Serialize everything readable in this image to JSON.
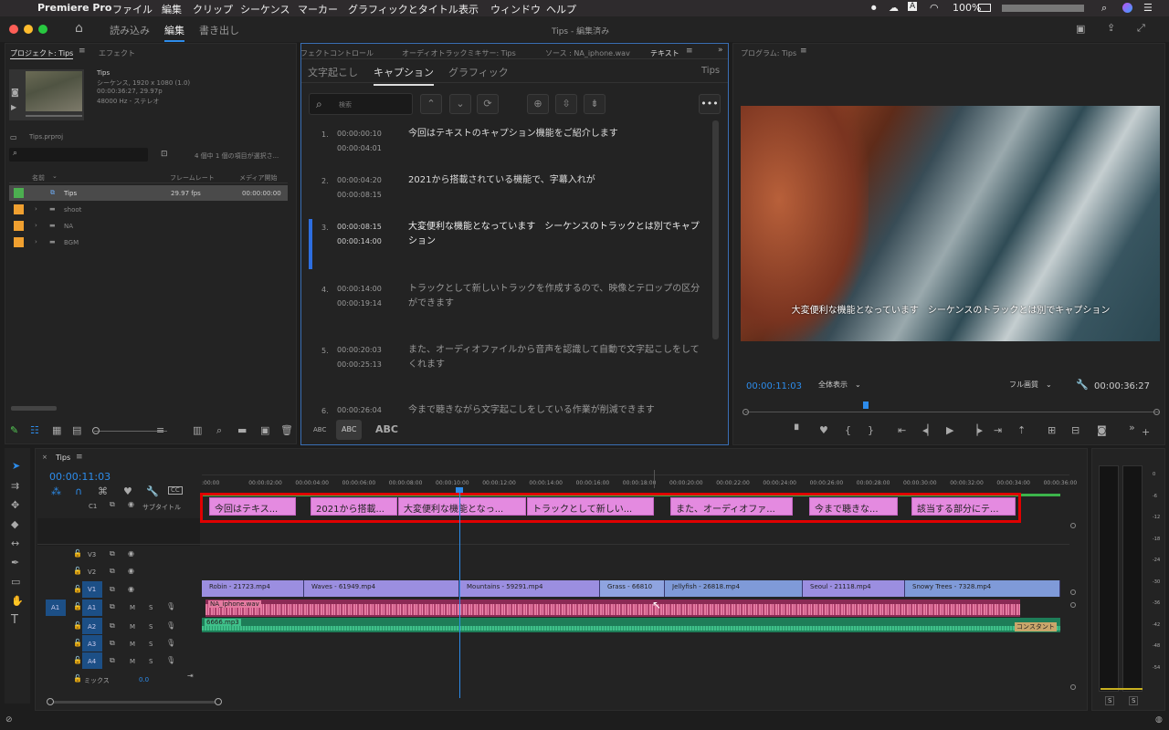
{
  "menubar": {
    "apple": "",
    "app": "Premiere Pro",
    "items": [
      "ファイル",
      "編集",
      "クリップ",
      "シーケンス",
      "マーカー",
      "グラフィックとタイトル",
      "表示",
      "ウィンドウ",
      "ヘルプ"
    ],
    "battery": "100%",
    "right_icons": [
      "search-icon",
      "control-center-icon",
      "siri-icon"
    ]
  },
  "appbar": {
    "workspaces": [
      "読み込み",
      "編集",
      "書き出し"
    ],
    "title": "Tips - 編集済み"
  },
  "project": {
    "tabs": [
      "プロジェクト: Tips",
      "エフェクト"
    ],
    "seq_name": "Tips",
    "seq_info1": "シーケンス, 1920 x 1080 (1.0)",
    "seq_info2": "00:00:36:27, 29.97p",
    "seq_info3": "48000 Hz - ステレオ",
    "file": "Tips.prproj",
    "selection": "4 個中 1 個の項目が選択さ...",
    "columns": [
      "名前",
      "フレームレート",
      "メディア開始"
    ],
    "rows": [
      {
        "name": "Tips",
        "fps": "29.97 fps",
        "start": "00:00:00:00",
        "color": "#4caf50"
      },
      {
        "name": "shoot",
        "fps": "",
        "start": "",
        "color": "#f0a030"
      },
      {
        "name": "NA",
        "fps": "",
        "start": "",
        "color": "#f0a030"
      },
      {
        "name": "BGM",
        "fps": "",
        "start": "",
        "color": "#f0a030"
      }
    ]
  },
  "textpanel": {
    "tabs": [
      "フェクトコントロール",
      "オーディオトラックミキサー: Tips",
      "ソース : NA_iphone.wav",
      "テキスト"
    ],
    "subtabs": [
      "文字起こし",
      "キャプション",
      "グラフィック"
    ],
    "seq": "Tips",
    "search_placeholder": "検索",
    "bottom": [
      "ABC",
      "ABC",
      "ABC"
    ],
    "captions": [
      {
        "num": "1.",
        "in": "00:00:00:10",
        "out": "00:00:04:01",
        "text": "今回はテキストのキャプション機能をご紹介します"
      },
      {
        "num": "2.",
        "in": "00:00:04:20",
        "out": "00:00:08:15",
        "text": "2021から搭載されている機能で、字幕入れが"
      },
      {
        "num": "3.",
        "in": "00:00:08:15",
        "out": "00:00:14:00",
        "text": "大変便利な機能となっています　シーケンスのトラックとは別でキャプション"
      },
      {
        "num": "4.",
        "in": "00:00:14:00",
        "out": "00:00:19:14",
        "text": "トラックとして新しいトラックを作成するので、映像とテロップの区分ができます"
      },
      {
        "num": "5.",
        "in": "00:00:20:03",
        "out": "00:00:25:13",
        "text": "また、オーディオファイルから音声を認識して自動で文字起こしをしてくれます"
      },
      {
        "num": "6.",
        "in": "00:00:26:04",
        "out": "",
        "text": "今まで聴きながら文字起こしをしている作業が削減できます"
      }
    ]
  },
  "program": {
    "tab": "プログラム: Tips",
    "subtitle": "大変便利な機能となっています　シーケンスのトラックとは別でキャプション",
    "timecode": "00:00:11:03",
    "fit": "全体表示",
    "quality": "フル画質",
    "duration": "00:00:36:27"
  },
  "timeline": {
    "tab": "Tips",
    "timecode": "00:00:11:03",
    "ruler": [
      ":00:00",
      "00:00:02:00",
      "00:00:04:00",
      "00:00:06:00",
      "00:00:08:00",
      "00:00:10:00",
      "00:00:12:00",
      "00:00:14:00",
      "00:00:16:00",
      "00:00:18:00",
      "00:00:20:00",
      "00:00:22:00",
      "00:00:24:00",
      "00:00:26:00",
      "00:00:28:00",
      "00:00:30:00",
      "00:00:32:00",
      "00:00:34:00",
      "00:00:36:00"
    ],
    "caption_track": "サブタイトル",
    "caption_track_id": "C1",
    "caption_clips": [
      "今回はテキス...",
      "2021から搭載...",
      "大変便利な機能となっ...",
      "トラックとして新しい...",
      "また、オーディオファ...",
      "今まで聴きな...",
      "該当する部分にテ..."
    ],
    "tracks": [
      "V3",
      "V2",
      "V1",
      "A1",
      "A2",
      "A3",
      "A4"
    ],
    "source_a1": "A1",
    "mix_label": "ミックス",
    "mix_value": "0.0",
    "video_clips": [
      "Robin - 21723.mp4",
      "Waves - 61949.mp4",
      "Mountains - 59291.mp4",
      "Grass - 66810",
      "Jellyfish - 26818.mp4",
      "Seoul - 21118.mp4",
      "Snowy Trees - 7328.mp4"
    ],
    "audio_clips": [
      "NA_iphone.wav",
      "6666.mp3",
      "コンスタント"
    ]
  },
  "meter": {
    "labels": [
      "0",
      "-6",
      "-12",
      "-18",
      "-24",
      "-30",
      "-36",
      "-42",
      "-48",
      "-54"
    ],
    "solo": [
      "S",
      "S"
    ]
  },
  "colors": {
    "accent": "#2d8ceb",
    "caption": "#e48ae0",
    "video": "#9b8ee0",
    "video_blue": "#7f9ad8",
    "audio_pink": "#e47aa0",
    "audio_green": "#3fc08a",
    "highlight": "#e00000"
  }
}
